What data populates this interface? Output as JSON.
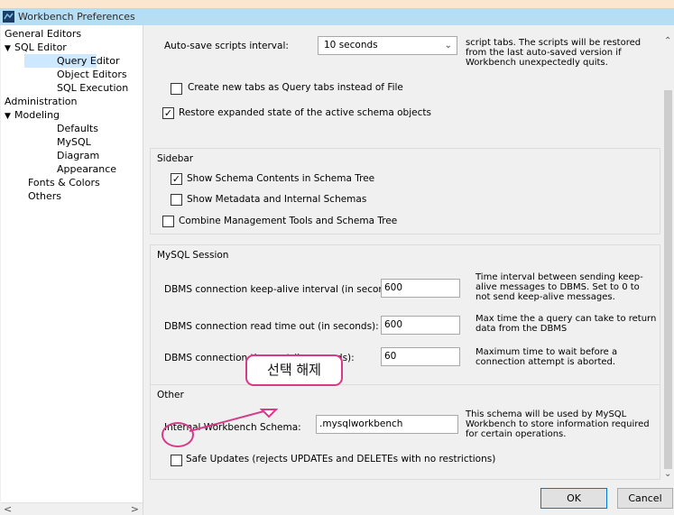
{
  "window": {
    "title": "Workbench Preferences"
  },
  "sidebar": {
    "items": [
      {
        "label": "General Editors"
      },
      {
        "label": "SQL Editor",
        "arrow": "▼"
      },
      {
        "label": "Query Editor"
      },
      {
        "label": "Object Editors"
      },
      {
        "label": "SQL Execution"
      },
      {
        "label": "Administration"
      },
      {
        "label": "Modeling",
        "arrow": "▼"
      },
      {
        "label": "Defaults"
      },
      {
        "label": "MySQL"
      },
      {
        "label": "Diagram"
      },
      {
        "label": "Appearance"
      },
      {
        "label": "Fonts & Colors"
      },
      {
        "label": "Others"
      }
    ],
    "scroll_left": "<",
    "scroll_right": ">"
  },
  "general": {
    "autosave_label": "Auto-save scripts interval:",
    "autosave_value": "10 seconds",
    "autosave_note": "script tabs. The scripts will be restored from the last auto-saved version if Workbench unexpectedly quits.",
    "create_tabs_label": "Create new tabs as Query tabs instead of File",
    "create_tabs_checked": false,
    "restore_state_label": "Restore expanded state of the active schema objects",
    "restore_state_checked": true
  },
  "sidebar_group": {
    "title": "Sidebar",
    "show_schema_contents": "Show Schema Contents in Schema Tree",
    "show_schema_contents_checked": true,
    "show_metadata": "Show Metadata and Internal Schemas",
    "show_metadata_checked": false,
    "combine_tools": "Combine Management Tools and Schema Tree",
    "combine_tools_checked": false
  },
  "session": {
    "title": "MySQL Session",
    "keepalive_label": "DBMS connection keep-alive interval (in seconds):",
    "keepalive_value": "600",
    "keepalive_note": "Time interval between sending keep-alive messages to DBMS. Set to 0 to not send keep-alive messages.",
    "read_timeout_label": "DBMS connection read time out (in seconds):",
    "read_timeout_value": "600",
    "read_timeout_note": "Max time the a query can take to return data from the DBMS",
    "conn_timeout_label": "DBMS connection time out (in seconds):",
    "conn_timeout_value": "60",
    "conn_timeout_note": "Maximum time to wait before a connection attempt is aborted."
  },
  "other": {
    "title": "Other",
    "schema_label": "Internal Workbench Schema:",
    "schema_value": ".mysqlworkbench",
    "schema_note": "This schema will be used by MySQL Workbench to store information required for certain operations.",
    "safe_updates_label": "Safe Updates (rejects UPDATEs and DELETEs with no restrictions)",
    "safe_updates_checked": false
  },
  "buttons": {
    "ok": "OK",
    "cancel": "Cancel"
  },
  "annotation": {
    "text": "선택 해제"
  },
  "colors": {
    "titlebar": "#b5def5",
    "annotation": "#d63b8a",
    "selection": "#cde8ff"
  }
}
